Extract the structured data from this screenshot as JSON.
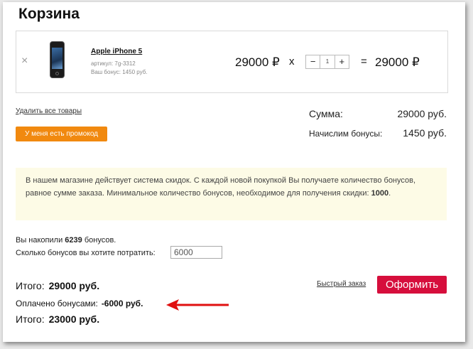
{
  "page": {
    "title": "Корзина"
  },
  "cart": {
    "remove_icon": "×",
    "item": {
      "name": "Apple iPhone 5",
      "article": "артикул: 7g-3312",
      "bonus": "Ваш бонус: 1450 руб.",
      "price": "29000 ₽",
      "multiply": "x",
      "quantity": "1",
      "minus": "−",
      "plus": "+",
      "equals": "=",
      "line_total": "29000 ₽"
    },
    "remove_all_label": "Удалить все товары",
    "promo_label": "У меня есть промокод"
  },
  "summary": {
    "sum_label": "Сумма:",
    "sum_value": "29000 руб.",
    "bonus_label": "Начислим бонусы:",
    "bonus_value": "1450 руб."
  },
  "notice": {
    "text": "В нашем магазине действует система скидок. С каждой новой покупкой Вы получаете количество бонусов, равное сумме заказа. Минимальное количество бонусов, необходимое для получения скидки: ",
    "min_bonus": "1000",
    "end": "."
  },
  "bonuses": {
    "accumulated_prefix": "Вы накопили",
    "accumulated_value": "6239",
    "accumulated_suffix": "бонусов.",
    "spend_label": "Сколько бонусов вы хотите потратить:",
    "spend_value": "6000"
  },
  "totals": {
    "total_label": "Итого:",
    "total_value": "29000 руб.",
    "paid_label": "Оплачено бонусами:",
    "paid_value": "-6000 руб.",
    "final_label": "Итого:",
    "final_value": "23000 руб."
  },
  "actions": {
    "quick_order": "Быстрый заказ",
    "checkout": "Оформить"
  },
  "colors": {
    "promo": "#f1890f",
    "checkout": "#d60e3c",
    "notice_bg": "#fdfbe6",
    "arrow": "#e01010"
  },
  "icons": {
    "product": "phone-image",
    "arrow": "red-arrow-icon"
  }
}
